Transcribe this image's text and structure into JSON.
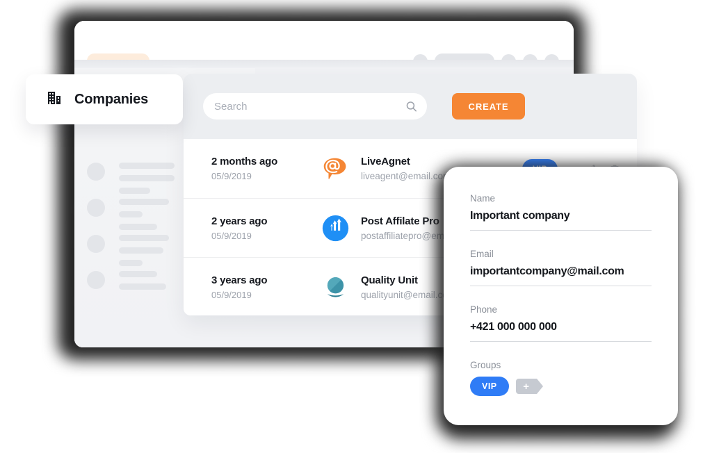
{
  "browser": {
    "topbar": {
      "brand_placeholder": "",
      "right_placeholders": [
        "dot",
        "pill",
        "dot",
        "dot",
        "dot"
      ]
    }
  },
  "sidebar": {
    "skeleton_groups": [
      {
        "bars": [
          80,
          80,
          45
        ]
      },
      {
        "bars": [
          72,
          34,
          55
        ]
      },
      {
        "bars": [
          72,
          64,
          34
        ]
      },
      {
        "bars": [
          55,
          68
        ]
      }
    ]
  },
  "tab": {
    "icon": "building-icon",
    "label": "Companies"
  },
  "toolbar": {
    "search_placeholder": "Search",
    "search_value": "",
    "search_icon": "search-icon",
    "create_label": "CREATE"
  },
  "list": {
    "rows": [
      {
        "relative_date": "2 months ago",
        "date": "05/9/2019",
        "logo": "liveagent-logo",
        "name": "LiveAgnet",
        "email": "liveagent@email.com",
        "badge": "VIP",
        "edit_icon": "pencil-icon",
        "delete_icon": "trash-icon"
      },
      {
        "relative_date": "2 years ago",
        "date": "05/9/2019",
        "logo": "postaffiliatepro-logo",
        "name": "Post Affilate Pro",
        "email": "postaffiliatepro@email.com",
        "badge": "",
        "edit_icon": "pencil-icon",
        "delete_icon": "trash-icon"
      },
      {
        "relative_date": "3 years ago",
        "date": "05/9/2019",
        "logo": "qualityunit-logo",
        "name": "Quality Unit",
        "email": "qualityunit@email.com",
        "badge": "",
        "edit_icon": "pencil-icon",
        "delete_icon": "trash-icon"
      }
    ]
  },
  "detail": {
    "name_label": "Name",
    "name_value": "Important company",
    "email_label": "Email",
    "email_value": "importantcompany@mail.com",
    "phone_label": "Phone",
    "phone_value": "+421 000 000 000",
    "groups_label": "Groups",
    "group_vip": "VIP",
    "add_group_icon": "plus-icon",
    "add_group_glyph": "+"
  },
  "colors": {
    "accent_orange": "#F58634",
    "accent_blue": "#2F7CF6",
    "teal": "#3D93A8",
    "panel_bg": "#ECEEF1",
    "window_bg": "#F1F2F5",
    "skeleton": "#E3E5E9",
    "text_dark": "#16191F",
    "text_muted": "#9EA3AC"
  }
}
